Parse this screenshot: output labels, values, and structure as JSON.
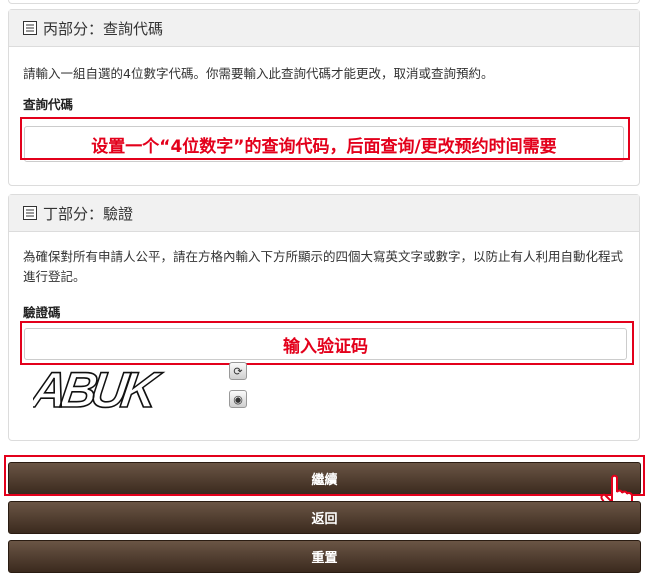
{
  "section_c": {
    "title": "丙部分：查詢代碼",
    "description": "請輸入一組自選的4位數字代碼。你需要輸入此查詢代碼才能更改，取消或查詢預約。",
    "field_label": "查詢代碼",
    "annotation": "设置一个“4位数字”的查询代码，后面查询/更改预约时间需要"
  },
  "section_d": {
    "title": "丁部分：驗證",
    "description": "為確保對所有申請人公平，請在方格內輸入下方所顯示的四個大寫英文字或數字，以防止有人利用自動化程式進行登記。",
    "field_label": "驗證碼",
    "annotation": "输入验证码",
    "captcha_text": "ABUK"
  },
  "buttons": {
    "continue": "繼續",
    "back": "返回",
    "reset": "重置"
  },
  "colors": {
    "annotation_red": "#e3001b",
    "button_brown": "#4a382b"
  }
}
